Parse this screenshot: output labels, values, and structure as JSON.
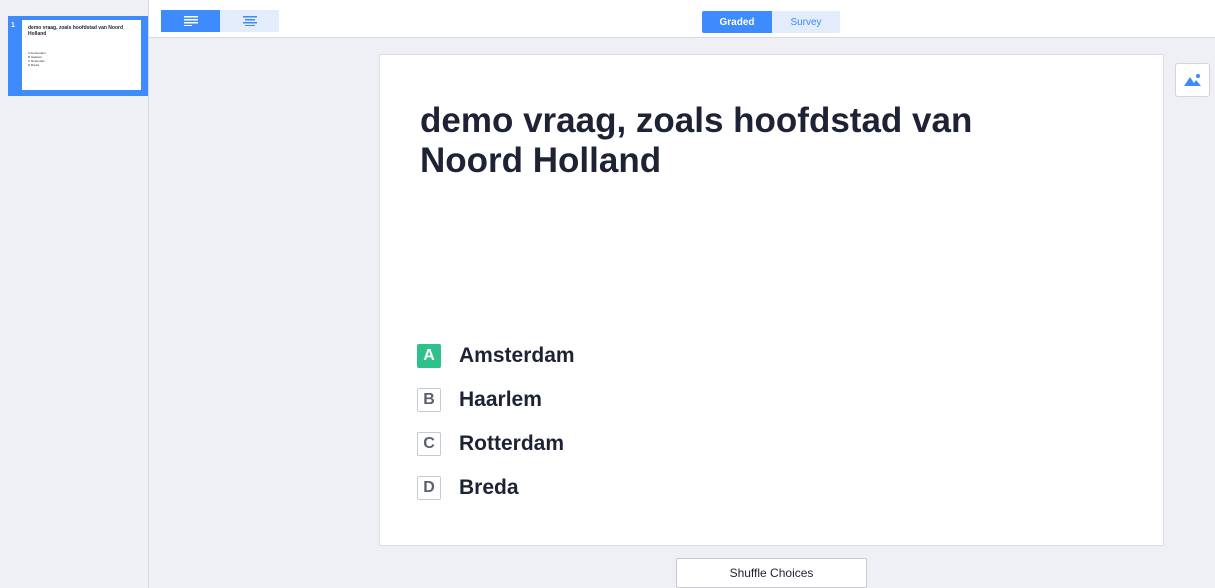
{
  "sidebar": {
    "slides": [
      {
        "number": "1",
        "title": "demo vraag, zoals hoofdstad van Noord Holland",
        "choices": [
          "A  Amsterdam",
          "B  Haarlem",
          "C  Rotterdam",
          "D  Breda"
        ]
      }
    ]
  },
  "toolbar": {
    "align_left_icon": "align-left-icon",
    "align_center_icon": "align-center-icon",
    "mode_graded": "Graded",
    "mode_survey": "Survey"
  },
  "question": {
    "title": "demo vraag, zoals hoofdstad van Noord Holland",
    "choices": [
      {
        "letter": "A",
        "text": "Amsterdam",
        "correct": true
      },
      {
        "letter": "B",
        "text": "Haarlem",
        "correct": false
      },
      {
        "letter": "C",
        "text": "Rotterdam",
        "correct": false
      },
      {
        "letter": "D",
        "text": "Breda",
        "correct": false
      }
    ]
  },
  "actions": {
    "shuffle_label": "Shuffle Choices",
    "image_icon": "image-icon"
  },
  "colors": {
    "accent": "#3d8bfd",
    "correct": "#2fc18c",
    "background": "#eff0f6"
  }
}
